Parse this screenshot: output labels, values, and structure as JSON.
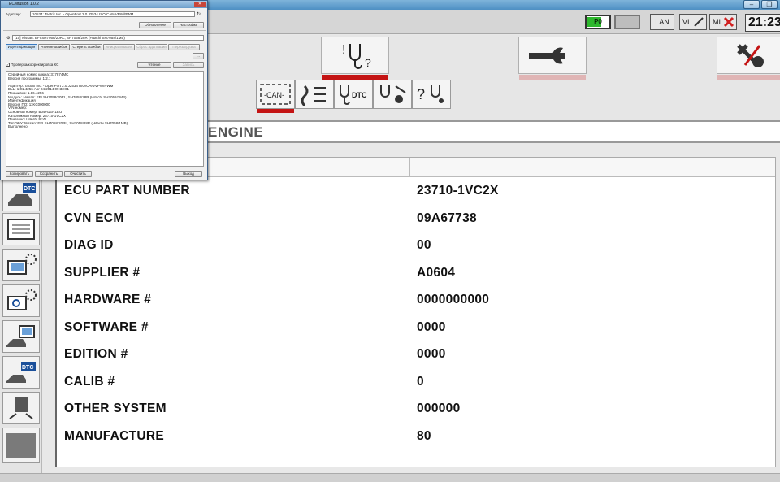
{
  "statusbar": {
    "battery_label": "P0",
    "lan_label": "LAN",
    "vi_label": "VI",
    "mi_label": "MI",
    "clock": "21:23"
  },
  "section": {
    "title": "ENGINE"
  },
  "table": {
    "rows": [
      {
        "key": "ECU PART NUMBER",
        "value": "23710-1VC2X"
      },
      {
        "key": "CVN ECM",
        "value": "09A67738"
      },
      {
        "key": "DIAG ID",
        "value": "00"
      },
      {
        "key": "SUPPLIER #",
        "value": "A0604"
      },
      {
        "key": "HARDWARE #",
        "value": "0000000000"
      },
      {
        "key": "SOFTWARE #",
        "value": "0000"
      },
      {
        "key": "EDITION #",
        "value": "0000"
      },
      {
        "key": "CALIB #",
        "value": "0"
      },
      {
        "key": "OTHER SYSTEM",
        "value": "000000"
      },
      {
        "key": "MANUFACTURE",
        "value": "80"
      }
    ]
  },
  "toolbar": {
    "can_label": "-CAN-",
    "dtc_label": "DTC"
  },
  "rail": {
    "dtc_label": "DTC",
    "dtc2_label": "DTC"
  },
  "ecm": {
    "title": "ECMfusion 1.0.2",
    "adapter_label": "Адаптер:",
    "adapter_value": "10534: Tactrix Inc. - OpenPort 2.0 J2534 ISO/CAN/VPW/PWM",
    "btn_update": "Обновление",
    "btn_settings": "Настройки",
    "ecu_value": "[10] Nissan: EFI SH7058/20RL, SH7058/28R (Hitachi SH7058/1MB)",
    "tabs": [
      "Идентификация",
      "Чтение ошибок",
      "Стереть ошибки",
      "Инициализация",
      "Сброс адаптации",
      "Перезагрузка"
    ],
    "btn_small": "...",
    "checkbox_label": "Проверка/корректировка КС",
    "btn_read": "Чтение",
    "btn_write": "Запись",
    "log": [
      "Серийный номер ключа: 317874MC",
      "Версия программы: 1.2.1",
      "",
      "Адаптер: Tactrix Inc. - OpenPort 2.0 J2534 ISO/CAN/VPW/PWM",
      "DLL: 1.01.4256 Apr 24 2014 09:33:01",
      "Прошивка: 1.16.4256",
      "Модуль: Nissan: EFI SH7058/20RL, SH7058/28R (Hitachi SH7058/1MB)",
      "Идентификация",
      "Версия ПО:          11KC000000",
      "VIN номер:",
      "Основной номер:     B04H1ER1EU",
      "Каталожный номер:   23710-1VC2X",
      "Протокол:           Hitachi CAN",
      "Тип ЭБУ: Nissan: EFI SH7058/20RL, SH7058/28R (Hitachi SH7058/1MB)",
      "Выполнено"
    ],
    "btn_copy": "Копировать",
    "btn_save": "Сохранить",
    "btn_clear": "Очистить",
    "btn_exit": "Выход"
  }
}
